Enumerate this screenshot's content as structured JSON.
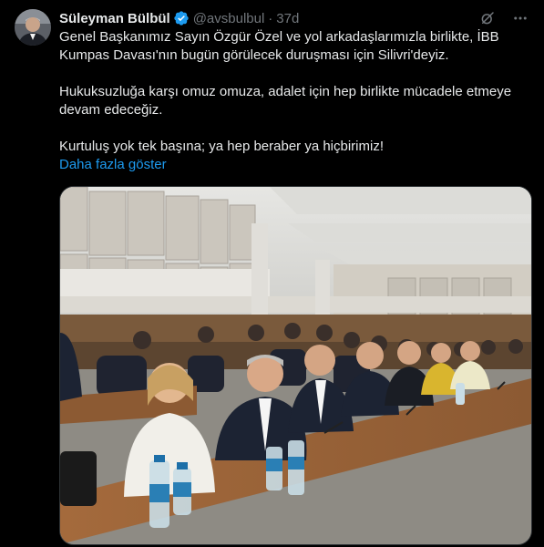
{
  "author": {
    "name": "Süleyman Bülbül",
    "handle": "@avsbulbul",
    "separator": "·",
    "time": "37d",
    "verified_color": "#1d9bf0"
  },
  "header_icons": [
    "grok-icon",
    "more-icon"
  ],
  "tweet": {
    "paragraph1": "Genel Başkanımız Sayın Özgür Özel ve yol arkadaşlarımızla birlikte, İBB Kumpas Davası'nın bugün görülecek duruşması için Silivri'deyiz.",
    "paragraph2": "Hukuksuzluğa karşı omuz omuza, adalet için hep birlikte mücadele etmeye devam edeceğiz.",
    "paragraph3": "Kurtuluş yok tek başına; ya hep beraber ya hiçbirimiz!",
    "show_more": "Daha fazla göster"
  },
  "colors": {
    "background": "#000000",
    "text": "#e7e9ea",
    "secondary": "#71767b",
    "link": "#1d9bf0"
  }
}
